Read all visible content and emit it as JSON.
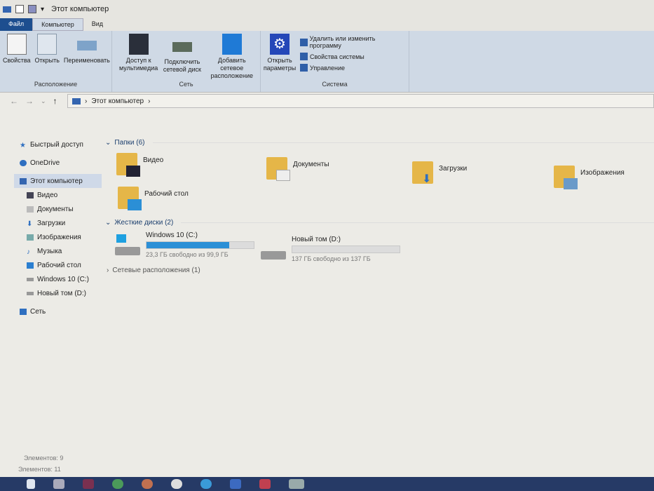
{
  "window": {
    "title": "Этот компьютер"
  },
  "tabs": [
    "Файл",
    "Компьютер",
    "Вид"
  ],
  "ribbon": {
    "location": {
      "label": "Расположение",
      "buttons": [
        "Свойства",
        "Открыть",
        "Переименовать"
      ]
    },
    "network": {
      "label": "Сеть",
      "buttons": [
        "Доступ к мультимедиа",
        "Подключить сетевой диск",
        "Добавить сетевое расположение"
      ]
    },
    "system": {
      "label": "Система",
      "open_settings": "Открыть параметры",
      "items": [
        "Удалить или изменить программу",
        "Свойства системы",
        "Управление"
      ]
    }
  },
  "address": {
    "path": "Этот компьютер"
  },
  "sidebar": {
    "items": [
      "Быстрый доступ",
      "OneDrive",
      "Этот компьютер",
      "Видео",
      "Документы",
      "Загрузки",
      "Изображения",
      "Музыка",
      "Рабочий стол",
      "Windows 10 (C:)",
      "Новый том (D:)",
      "Сеть"
    ]
  },
  "folders": {
    "header": "Папки (6)",
    "items": [
      "Видео",
      "Документы",
      "Загрузки",
      "Изображения",
      "Рабочий стол"
    ]
  },
  "drives": {
    "header": "Жесткие диски (2)",
    "items": [
      {
        "name": "Windows 10 (C:)",
        "free": "23,3 ГБ свободно из 99,9 ГБ",
        "used_percent": 77
      },
      {
        "name": "Новый том (D:)",
        "free": "137 ГБ свободно из 137 ГБ",
        "used_percent": 0
      }
    ]
  },
  "network_locations": {
    "header": "Сетевые расположения (1)"
  },
  "status": {
    "line1": "Элементов: 9",
    "line2": "Элементов: 11"
  },
  "colors": {
    "accent": "#1d4e8f",
    "drive_bar": "#2b8fd6",
    "folder": "#e5b648"
  }
}
